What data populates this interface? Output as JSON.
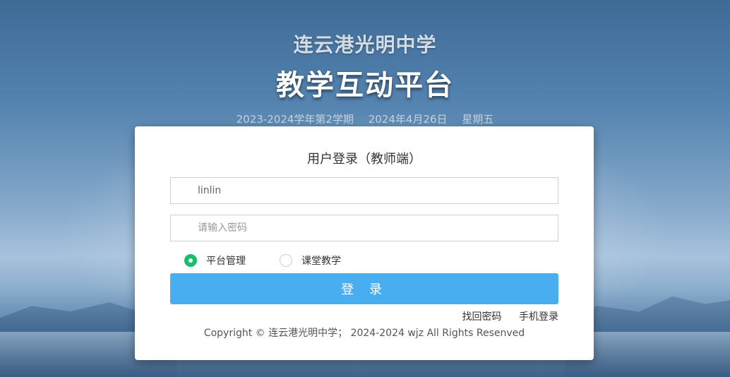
{
  "header": {
    "school_name": "连云港光明中学",
    "platform_name": "教学互动平台",
    "term": "2023-2024学年第2学期",
    "date": "2024年4月26日",
    "weekday": "星期五"
  },
  "login": {
    "title": "用户登录（教师端）",
    "username_value": "linlin",
    "username_placeholder": "",
    "password_placeholder": "请输入密码",
    "roles": [
      {
        "label": "平台管理",
        "checked": true
      },
      {
        "label": "课堂教学",
        "checked": false
      }
    ],
    "submit_label": "登 录",
    "forgot_password": "找回密码",
    "phone_login": "手机登录",
    "copyright": "Copyright © 连云港光明中学；  2024-2024 wjz All Rights Resenved"
  },
  "colors": {
    "button": "#48aeef",
    "radio_checked": "#19be6b"
  }
}
